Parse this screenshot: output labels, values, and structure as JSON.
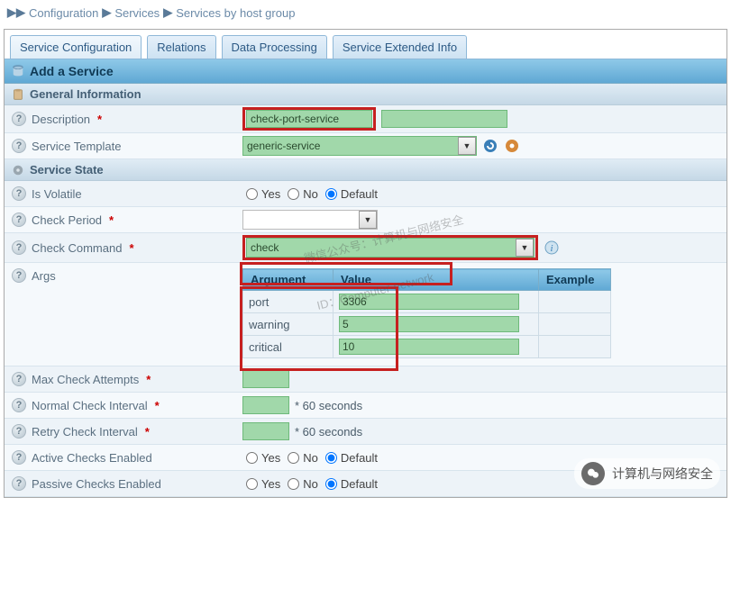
{
  "breadcrumb": {
    "a": "Configuration",
    "b": "Services",
    "c": "Services by host group"
  },
  "tabs": {
    "t1": "Service Configuration",
    "t2": "Relations",
    "t3": "Data Processing",
    "t4": "Service Extended Info"
  },
  "header": {
    "title": "Add a Service"
  },
  "sections": {
    "general": "General Information",
    "state": "Service State"
  },
  "labels": {
    "description": "Description",
    "template": "Service Template",
    "volatile": "Is Volatile",
    "check_period": "Check Period",
    "check_command": "Check Command",
    "args": "Args",
    "max_attempts": "Max Check Attempts",
    "normal_interval": "Normal Check Interval",
    "retry_interval": "Retry Check Interval",
    "active_checks": "Active Checks Enabled",
    "passive_checks": "Passive Checks Enabled"
  },
  "values": {
    "description": "check-port-service",
    "template": "generic-service",
    "check_command": "check"
  },
  "radios": {
    "yes": "Yes",
    "no": "No",
    "default": "Default"
  },
  "args_table": {
    "headers": {
      "arg": "Argument",
      "val": "Value",
      "ex": "Example"
    },
    "rows": [
      {
        "arg": "port",
        "val": "3306",
        "ex": ""
      },
      {
        "arg": "warning",
        "val": "5",
        "ex": ""
      },
      {
        "arg": "critical",
        "val": "10",
        "ex": ""
      }
    ]
  },
  "suffix": {
    "sixty": "* 60 seconds"
  },
  "watermark": {
    "line1": "微信公众号：计算机与网络安全",
    "line2": "ID：Computer-network"
  },
  "badge": {
    "text": "计算机与网络安全"
  }
}
